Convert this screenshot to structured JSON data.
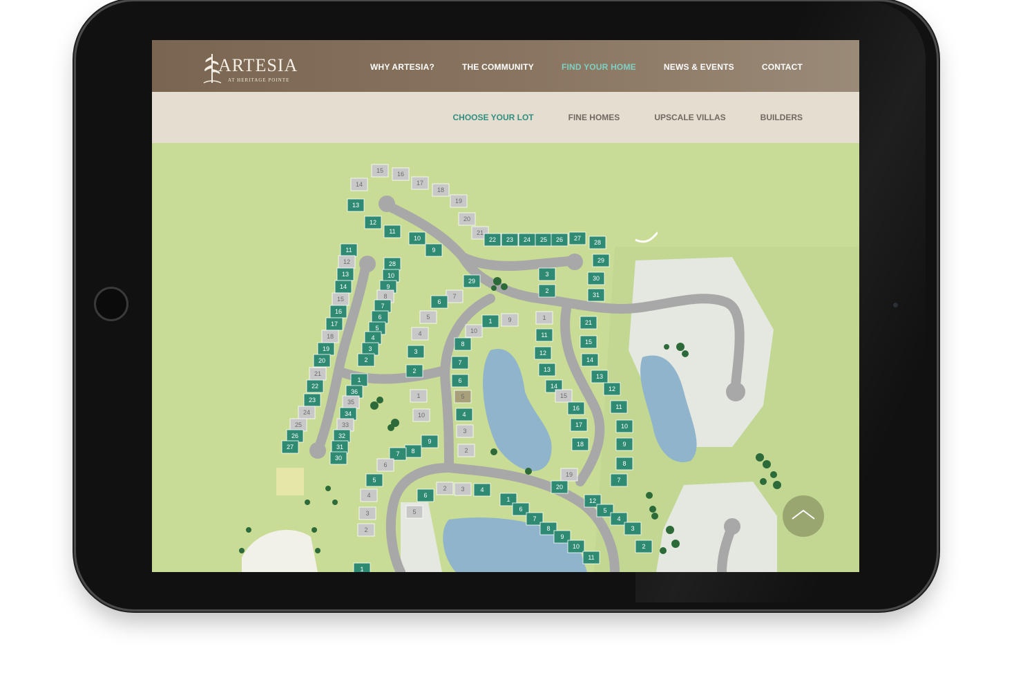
{
  "brand": {
    "name": "ARTESIA",
    "tagline": "AT HERITAGE POINTE"
  },
  "colors": {
    "accent": "#7fd0c4",
    "subnav_active": "#2f8f80",
    "lot_available": "#2f8a73",
    "lot_sold": "#c8c8c8",
    "lot_reserved": "#a8a07a",
    "grass": "#c8dc96",
    "water": "#8fb4cc",
    "road": "#a8a8a8"
  },
  "main_nav": [
    {
      "label": "WHY ARTESIA?",
      "active": false
    },
    {
      "label": "THE COMMUNITY",
      "active": false
    },
    {
      "label": "FIND YOUR HOME",
      "active": true
    },
    {
      "label": "NEWS & EVENTS",
      "active": false
    },
    {
      "label": "CONTACT",
      "active": false
    }
  ],
  "sub_nav": [
    {
      "label": "CHOOSE YOUR LOT",
      "active": true
    },
    {
      "label": "FINE HOMES",
      "active": false
    },
    {
      "label": "UPSCALE VILLAS",
      "active": false
    },
    {
      "label": "BUILDERS",
      "active": false
    }
  ],
  "scroll_top": {
    "icon": "chevron-up-icon"
  },
  "lots": [
    {
      "n": "15",
      "s": "sold"
    },
    {
      "n": "16",
      "s": "sold"
    },
    {
      "n": "17",
      "s": "sold"
    },
    {
      "n": "18",
      "s": "sold"
    },
    {
      "n": "19",
      "s": "sold"
    },
    {
      "n": "14",
      "s": "sold"
    },
    {
      "n": "20",
      "s": "sold"
    },
    {
      "n": "21",
      "s": "sold"
    },
    {
      "n": "13",
      "s": "available"
    },
    {
      "n": "12",
      "s": "available"
    },
    {
      "n": "11",
      "s": "available"
    },
    {
      "n": "10",
      "s": "available"
    },
    {
      "n": "9",
      "s": "available"
    },
    {
      "n": "22",
      "s": "available"
    },
    {
      "n": "23",
      "s": "available"
    },
    {
      "n": "24",
      "s": "available"
    },
    {
      "n": "25",
      "s": "available"
    },
    {
      "n": "26",
      "s": "available"
    },
    {
      "n": "27",
      "s": "available"
    },
    {
      "n": "28",
      "s": "available"
    },
    {
      "n": "29",
      "s": "available"
    },
    {
      "n": "30",
      "s": "available"
    },
    {
      "n": "31",
      "s": "available"
    },
    {
      "n": "3",
      "s": "available"
    },
    {
      "n": "2",
      "s": "available"
    },
    {
      "n": "11",
      "s": "available"
    },
    {
      "n": "12",
      "s": "sold"
    },
    {
      "n": "13",
      "s": "available"
    },
    {
      "n": "14",
      "s": "available"
    },
    {
      "n": "15",
      "s": "sold"
    },
    {
      "n": "16",
      "s": "available"
    },
    {
      "n": "17",
      "s": "available"
    },
    {
      "n": "18",
      "s": "sold"
    },
    {
      "n": "19",
      "s": "available"
    },
    {
      "n": "20",
      "s": "available"
    },
    {
      "n": "21",
      "s": "sold"
    },
    {
      "n": "22",
      "s": "available"
    },
    {
      "n": "23",
      "s": "available"
    },
    {
      "n": "24",
      "s": "sold"
    },
    {
      "n": "25",
      "s": "sold"
    },
    {
      "n": "26",
      "s": "available"
    },
    {
      "n": "27",
      "s": "available"
    },
    {
      "n": "28",
      "s": "available"
    },
    {
      "n": "10",
      "s": "available"
    },
    {
      "n": "9",
      "s": "available"
    },
    {
      "n": "8",
      "s": "sold"
    },
    {
      "n": "7",
      "s": "available"
    },
    {
      "n": "6",
      "s": "available"
    },
    {
      "n": "5",
      "s": "available"
    },
    {
      "n": "4",
      "s": "available"
    },
    {
      "n": "3",
      "s": "available"
    },
    {
      "n": "2",
      "s": "available"
    },
    {
      "n": "1",
      "s": "available"
    },
    {
      "n": "36",
      "s": "available"
    },
    {
      "n": "35",
      "s": "sold"
    },
    {
      "n": "34",
      "s": "available"
    },
    {
      "n": "33",
      "s": "sold"
    },
    {
      "n": "32",
      "s": "available"
    },
    {
      "n": "31",
      "s": "available"
    },
    {
      "n": "30",
      "s": "available"
    },
    {
      "n": "29",
      "s": "available"
    },
    {
      "n": "7",
      "s": "sold"
    },
    {
      "n": "6",
      "s": "available"
    },
    {
      "n": "5",
      "s": "sold"
    },
    {
      "n": "4",
      "s": "sold"
    },
    {
      "n": "3",
      "s": "available"
    },
    {
      "n": "2",
      "s": "available"
    },
    {
      "n": "1",
      "s": "available"
    },
    {
      "n": "9",
      "s": "sold"
    },
    {
      "n": "10",
      "s": "sold"
    },
    {
      "n": "8",
      "s": "available"
    },
    {
      "n": "7",
      "s": "available"
    },
    {
      "n": "6",
      "s": "available"
    },
    {
      "n": "5",
      "s": "reserved"
    },
    {
      "n": "4",
      "s": "available"
    },
    {
      "n": "3",
      "s": "sold"
    },
    {
      "n": "2",
      "s": "sold"
    },
    {
      "n": "1",
      "s": "sold"
    },
    {
      "n": "10",
      "s": "sold"
    },
    {
      "n": "9",
      "s": "available"
    },
    {
      "n": "8",
      "s": "available"
    },
    {
      "n": "7",
      "s": "available"
    },
    {
      "n": "6",
      "s": "sold"
    },
    {
      "n": "5",
      "s": "available"
    },
    {
      "n": "4",
      "s": "sold"
    },
    {
      "n": "3",
      "s": "sold"
    },
    {
      "n": "2",
      "s": "sold"
    },
    {
      "n": "1",
      "s": "sold"
    },
    {
      "n": "11",
      "s": "available"
    },
    {
      "n": "12",
      "s": "available"
    },
    {
      "n": "13",
      "s": "available"
    },
    {
      "n": "14",
      "s": "available"
    },
    {
      "n": "15",
      "s": "sold"
    },
    {
      "n": "16",
      "s": "available"
    },
    {
      "n": "17",
      "s": "available"
    },
    {
      "n": "18",
      "s": "available"
    },
    {
      "n": "19",
      "s": "sold"
    },
    {
      "n": "20",
      "s": "available"
    },
    {
      "n": "21",
      "s": "available"
    },
    {
      "n": "15",
      "s": "available"
    },
    {
      "n": "14",
      "s": "available"
    },
    {
      "n": "13",
      "s": "available"
    },
    {
      "n": "12",
      "s": "available"
    },
    {
      "n": "11",
      "s": "available"
    },
    {
      "n": "10",
      "s": "available"
    },
    {
      "n": "9",
      "s": "available"
    },
    {
      "n": "8",
      "s": "available"
    },
    {
      "n": "7",
      "s": "available"
    },
    {
      "n": "6",
      "s": "available"
    },
    {
      "n": "2",
      "s": "sold"
    },
    {
      "n": "3",
      "s": "sold"
    },
    {
      "n": "4",
      "s": "available"
    },
    {
      "n": "5",
      "s": "sold"
    },
    {
      "n": "1",
      "s": "available"
    },
    {
      "n": "6",
      "s": "available"
    },
    {
      "n": "7",
      "s": "available"
    },
    {
      "n": "8",
      "s": "available"
    },
    {
      "n": "9",
      "s": "available"
    },
    {
      "n": "10",
      "s": "available"
    },
    {
      "n": "11",
      "s": "available"
    },
    {
      "n": "12",
      "s": "available"
    },
    {
      "n": "5",
      "s": "available"
    },
    {
      "n": "4",
      "s": "available"
    },
    {
      "n": "3",
      "s": "available"
    },
    {
      "n": "2",
      "s": "available"
    },
    {
      "n": "1",
      "s": "available"
    },
    {
      "n": "26",
      "s": "sold"
    }
  ]
}
